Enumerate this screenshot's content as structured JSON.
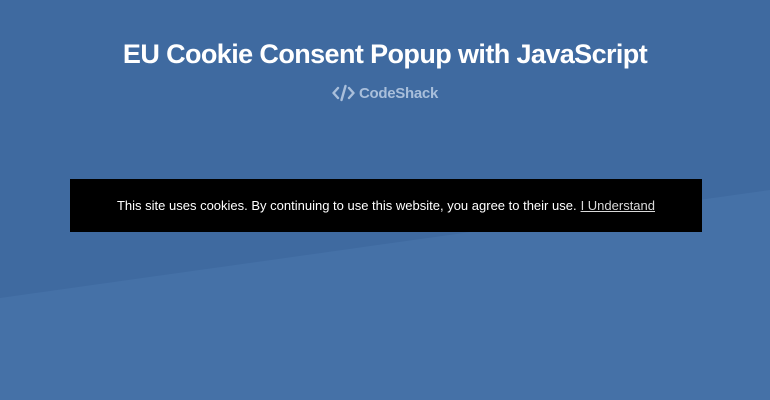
{
  "page": {
    "title": "EU Cookie Consent Popup with JavaScript",
    "brand_name": "CodeShack",
    "brand_icon": "code-brackets-icon"
  },
  "cookie_popup": {
    "message": "This site uses cookies. By continuing to use this website, you agree to their use.",
    "accept_label": "I Understand"
  },
  "colors": {
    "background": "#4571a7",
    "background_stripe": "#3f6aa0",
    "popup_background": "#000000",
    "popup_text": "#ffffff",
    "link_text": "#d9d9d9",
    "brand_text": "#a9bfdb"
  }
}
